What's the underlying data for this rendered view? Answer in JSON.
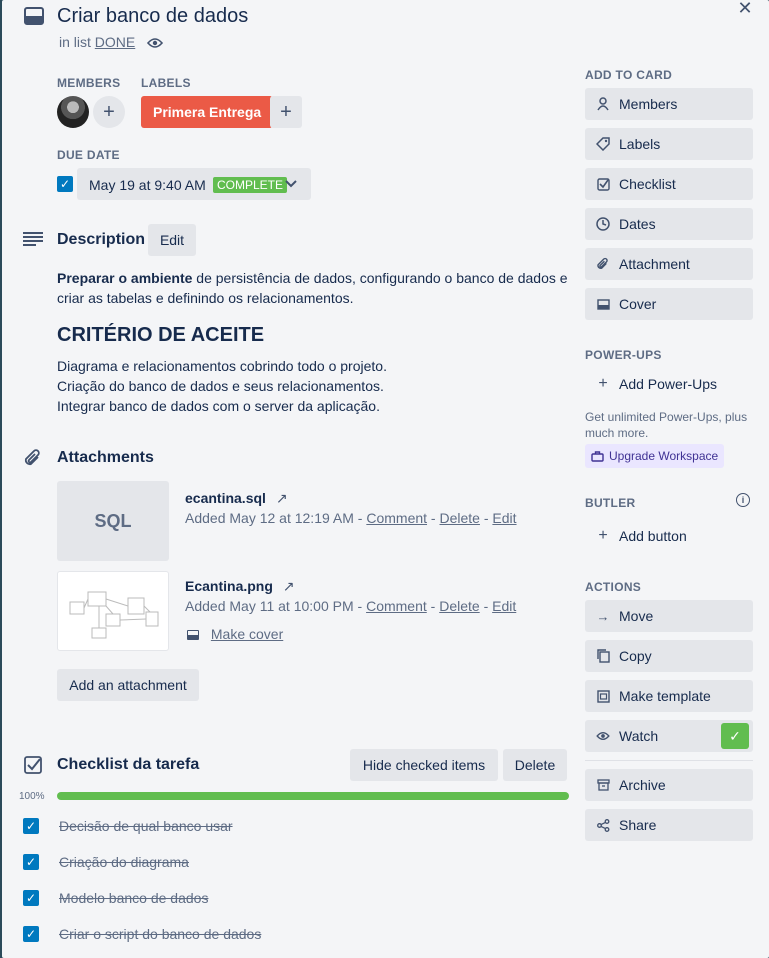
{
  "card": {
    "title": "Criar banco de dados",
    "in_list_prefix": "in list",
    "list_name": "DONE"
  },
  "members": {
    "heading": "Members"
  },
  "labels": {
    "heading": "Labels",
    "items": [
      {
        "text": "Primera Entrega",
        "color": "#eb5a46"
      }
    ]
  },
  "due_date": {
    "heading": "Due date",
    "value": "May 19 at 9:40 AM",
    "status": "COMPLETE",
    "checked": true
  },
  "description": {
    "heading": "Description",
    "edit_label": "Edit",
    "bold_lead": "Preparar o ambiente",
    "text_rest": " de persistência de dados, configurando o banco de dados e criar as tabelas e definindo os relacionamentos.",
    "criteria_heading": "CRITÉRIO DE ACEITE",
    "criteria_lines": [
      "Diagrama e relacionamentos cobrindo todo o projeto.",
      "Criação do banco de dados e seus relacionamentos.",
      "Integrar banco de dados com o server da aplicação."
    ]
  },
  "attachments": {
    "heading": "Attachments",
    "items": [
      {
        "thumb_label": "SQL",
        "name": "ecantina.sql",
        "added": "Added May 12 at 12:19 AM",
        "comment": "Comment",
        "delete": "Delete",
        "edit": "Edit"
      },
      {
        "thumb_label": "",
        "name": "Ecantina.png",
        "added": "Added May 11 at 10:00 PM",
        "comment": "Comment",
        "delete": "Delete",
        "edit": "Edit",
        "make_cover": "Make cover"
      }
    ],
    "add_label": "Add an attachment",
    "separator": "-"
  },
  "checklist": {
    "heading": "Checklist da tarefa",
    "hide_label": "Hide checked items",
    "delete_label": "Delete",
    "progress_text": "100%",
    "progress": 1.0,
    "items": [
      {
        "text": "Decisão de qual banco usar",
        "checked": true
      },
      {
        "text": "Criação do diagrama",
        "checked": true
      },
      {
        "text": "Modelo banco de dados",
        "checked": true
      },
      {
        "text": "Criar o script do banco de dados",
        "checked": true
      }
    ]
  },
  "sidebar": {
    "add_to_card_heading": "Add to card",
    "add_to_card": [
      {
        "label": "Members",
        "icon": "person-icon"
      },
      {
        "label": "Labels",
        "icon": "tag-icon"
      },
      {
        "label": "Checklist",
        "icon": "checklist-icon"
      },
      {
        "label": "Dates",
        "icon": "clock-icon"
      },
      {
        "label": "Attachment",
        "icon": "paperclip-icon"
      },
      {
        "label": "Cover",
        "icon": "cover-icon"
      }
    ],
    "powerups_heading": "Power-Ups",
    "add_powerups": "Add Power-Ups",
    "upsell_text": "Get unlimited Power-Ups, plus much more.",
    "upgrade_label": "Upgrade Workspace",
    "butler_heading": "Butler",
    "add_button": "Add button",
    "actions_heading": "Actions",
    "actions": [
      {
        "label": "Move",
        "icon": "arrow-right-icon"
      },
      {
        "label": "Copy",
        "icon": "copy-icon"
      },
      {
        "label": "Make template",
        "icon": "template-icon"
      },
      {
        "label": "Watch",
        "icon": "eye-icon",
        "active": true
      },
      {
        "label": "Archive",
        "icon": "archive-icon"
      },
      {
        "label": "Share",
        "icon": "share-icon"
      }
    ]
  },
  "colors": {
    "label_red": "#eb5a46",
    "complete_green": "#61bd4f",
    "checkbox_blue": "#0079bf",
    "upgrade_bg": "#eae6ff"
  }
}
